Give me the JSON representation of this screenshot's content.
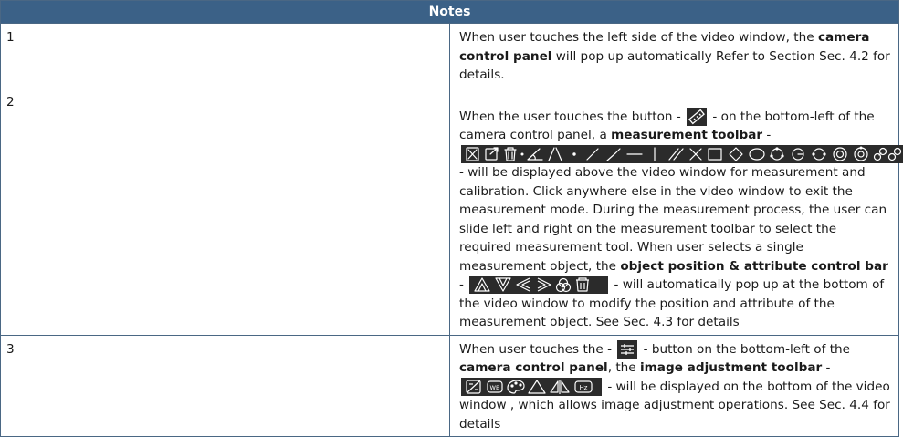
{
  "header": {
    "title": "Notes"
  },
  "rows": [
    {
      "number": "1",
      "s1": "When user touches the left side of the video window, the ",
      "b1": "camera control panel",
      "s2": " will pop up automatically  Refer to Section Sec. 4.2 for details."
    },
    {
      "number": "2",
      "s1": "When the user touches the button - ",
      "s2": " - on the bottom-left of the camera control panel, a ",
      "b1": "measurement toolbar",
      "s3": " - ",
      "s4": " - will be displayed above the video window for measurement and calibration. Click anywhere else in the video window to exit the measurement mode. During the measurement process, the user can slide left and right on the measurement toolbar to select the required measurement tool. When user selects a single measurement object, the ",
      "b2": "object position & attribute control bar",
      "s5": " - ",
      "s6": " -  will automatically pop up at the bottom of the video window to modify the position and attribute of the measurement object. See Sec. 4.3 for details"
    },
    {
      "number": "3",
      "s1": "When user touches the - ",
      "s2": " -  button on the bottom-left of the ",
      "b1": "camera control panel",
      "s3": ", the ",
      "b2": "image adjustment toolbar",
      "s4": " - ",
      "s5": " - will be displayed on the bottom of the video window , which allows image adjustment operations. See Sec. 4.4 for details"
    }
  ],
  "icons": {
    "ruler_button": "ruler-icon",
    "measurement_tools": [
      "delete-all-icon",
      "export-icon",
      "trash-icon",
      "angle-icon",
      "two-lines-angle-icon",
      "point-icon",
      "line-icon",
      "polyline-icon",
      "horizontal-line-icon",
      "vertical-line-icon",
      "parallel-lines-icon",
      "cross-lines-icon",
      "rectangle-icon",
      "diamond-icon",
      "ellipse-icon",
      "circle-3point-icon",
      "circle-center-icon",
      "arc-icon",
      "concentric-circles-icon",
      "ring-icon",
      "link-icon",
      "link-alt-icon"
    ],
    "position_attribute_tools": [
      "move-up-icon",
      "move-down-icon",
      "move-left-icon",
      "move-right-icon",
      "color-icon",
      "delete-icon"
    ],
    "adjust_button": "sliders-icon",
    "image_adjust_tools": [
      "exposure-icon",
      "white-balance-icon",
      "color-palette-icon",
      "triangle-icon",
      "mirror-icon",
      "hz-icon"
    ]
  },
  "icon_labels": {
    "white_balance": "WB",
    "hz": "Hz"
  },
  "colors": {
    "header_bg": "#3b6187",
    "border": "#4a6784",
    "icon_bg": "#2b2b2b",
    "icon_fg": "#ffffff"
  }
}
